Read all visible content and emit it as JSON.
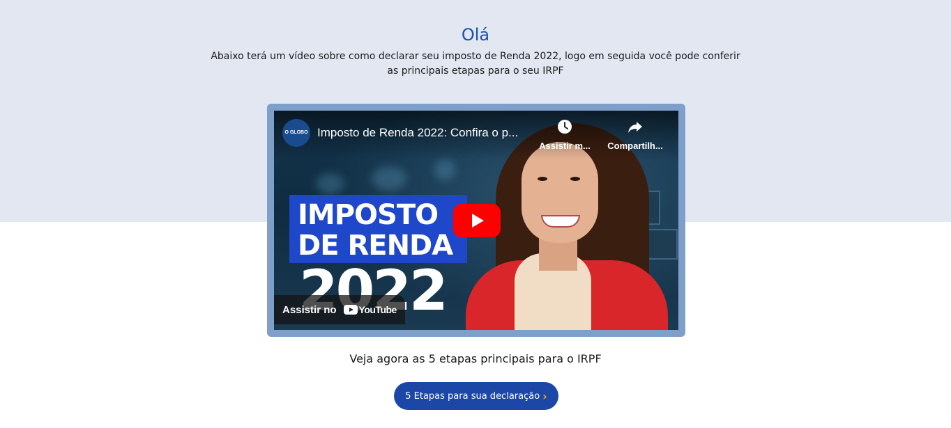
{
  "hero": {
    "greeting": "Olá",
    "intro_line1": "Abaixo terá um vídeo sobre como declarar seu imposto de Renda 2022, logo em seguida você pode conferir",
    "intro_line2": "as principais etapas para o seu IRPF"
  },
  "video": {
    "channel_logo_text": "O GLOBO",
    "title": "Imposto de Renda 2022: Confira o p...",
    "watch_later_label": "Assistir m...",
    "share_label": "Compartilh...",
    "watch_on_label": "Assistir no",
    "youtube_wordmark": "YouTube",
    "thumbnail_line1": "IMPOSTO",
    "thumbnail_line2": "DE RENDA",
    "thumbnail_year": "2022",
    "icons": {
      "clock": "clock-icon",
      "share": "share-icon",
      "play": "play-icon"
    }
  },
  "steps": {
    "heading": "Veja agora as 5 etapas principais para o IRPF",
    "button_label": "5 Etapas para sua declaração",
    "button_chevron": "›"
  },
  "colors": {
    "hero_bg": "#e3e7f1",
    "accent_blue": "#1d4fb0",
    "button_blue": "#1d47a6",
    "frame_blue": "#7f9fcb",
    "chevron_orange": "#f5a623",
    "youtube_red": "#ff0000"
  }
}
